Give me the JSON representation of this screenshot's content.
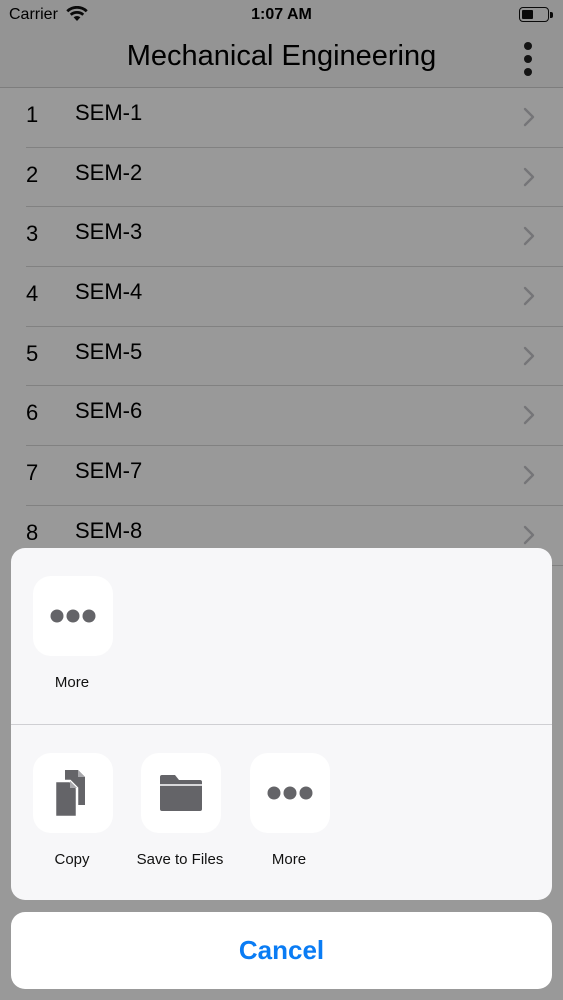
{
  "status_bar": {
    "carrier": "Carrier",
    "time": "1:07 AM"
  },
  "nav": {
    "title": "Mechanical Engineering"
  },
  "list": {
    "items": [
      {
        "num": "1",
        "label": "SEM-1"
      },
      {
        "num": "2",
        "label": "SEM-2"
      },
      {
        "num": "3",
        "label": "SEM-3"
      },
      {
        "num": "4",
        "label": "SEM-4"
      },
      {
        "num": "5",
        "label": "SEM-5"
      },
      {
        "num": "6",
        "label": "SEM-6"
      },
      {
        "num": "7",
        "label": "SEM-7"
      },
      {
        "num": "8",
        "label": "SEM-8"
      }
    ]
  },
  "share_sheet": {
    "top_actions": [
      {
        "label": "More",
        "icon": "more-icon"
      }
    ],
    "bottom_actions": [
      {
        "label": "Copy",
        "icon": "copy-icon"
      },
      {
        "label": "Save to Files",
        "icon": "folder-icon"
      },
      {
        "label": "More",
        "icon": "more-icon"
      }
    ],
    "cancel_label": "Cancel"
  },
  "colors": {
    "accent": "#0a7cf4",
    "icon_gray": "#646468"
  }
}
